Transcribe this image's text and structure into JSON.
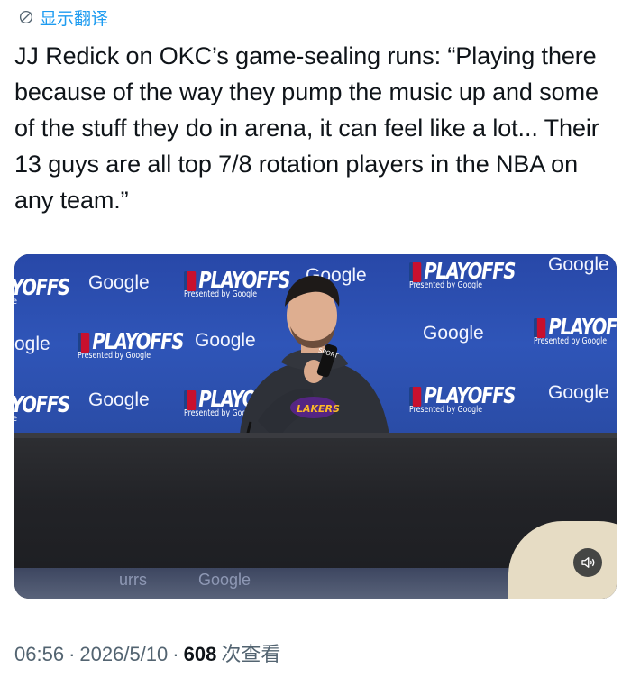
{
  "translate": {
    "label": "显示翻译",
    "icon": "globe-slash-icon"
  },
  "tweet": {
    "text": "JJ Redick on OKC’s game-sealing runs: “Playing there because of the way they pump the music up and some of the stuff they do in arena, it can feel like a lot... Their 13 guys are all top 7/8 rotation players in the NBA on any team.”"
  },
  "media": {
    "backdrop_google": "Google",
    "backdrop_playoffs": "PLAYOFFS",
    "backdrop_playoffs_partial_1": "YOFFS",
    "backdrop_playoffs_partial_2": "PLAYO",
    "backdrop_playoffs_partial_3": "YOFFS",
    "backdrop_playoffs_partial_4": "PLAYOFI",
    "backdrop_google_partial": "ogle",
    "backdrop_google_partial_2": "Googl",
    "backdrop_sub": "Presented by Google",
    "backdrop_partial_fragment": "le",
    "shirt_text": "LAKERS",
    "mic_text": "SPORT",
    "floor_text_1": "urrs",
    "floor_text_2": "Google",
    "mute_icon": "speaker-muted-icon",
    "colors": {
      "banner": "#2f55b8",
      "table": "#242529"
    }
  },
  "meta": {
    "time": "06:56",
    "separator": "·",
    "date": "2026/5/10",
    "views": "608",
    "views_label": "次查看"
  },
  "colors": {
    "link": "#1d9bf0",
    "text": "#0f1419",
    "muted": "#536471"
  }
}
